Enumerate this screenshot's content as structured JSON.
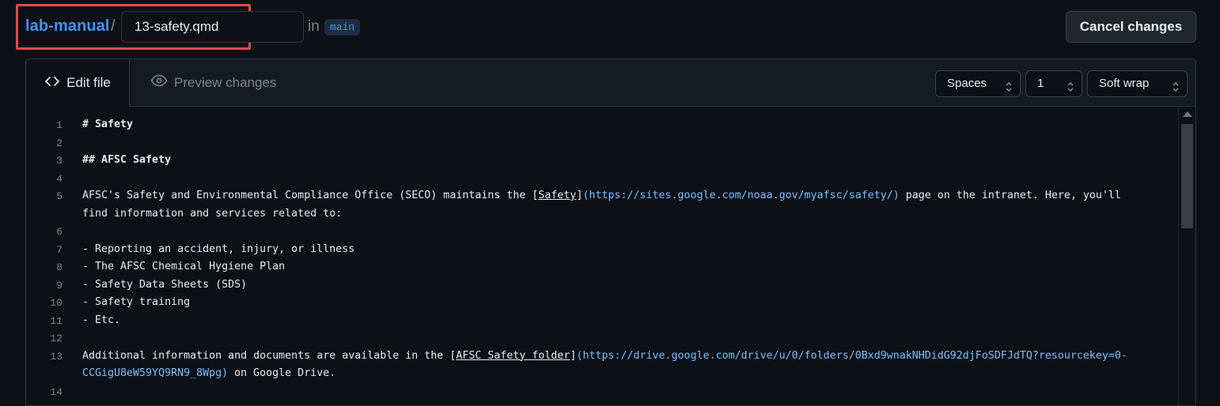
{
  "header": {
    "repo_name": "lab-manual",
    "separator": "/",
    "filename_value": "13-safety.qmd",
    "in_text": "in",
    "branch": "main",
    "cancel_label": "Cancel changes"
  },
  "editor": {
    "tabs": {
      "edit": "Edit file",
      "preview": "Preview changes"
    },
    "indent_mode": "Spaces",
    "indent_size": "1",
    "wrap_mode": "Soft wrap"
  },
  "code_lines": [
    {
      "n": "1",
      "segments": [
        {
          "t": "# Safety",
          "k": "heading"
        }
      ]
    },
    {
      "n": "2",
      "segments": []
    },
    {
      "n": "3",
      "segments": [
        {
          "t": "## AFSC Safety",
          "k": "heading"
        }
      ]
    },
    {
      "n": "4",
      "segments": []
    },
    {
      "n": "5",
      "segments": [
        {
          "t": "AFSC's Safety and Environmental Compliance Office (SECO) maintains the ",
          "k": "text"
        },
        {
          "t": "[",
          "k": "text"
        },
        {
          "t": "Safety",
          "k": "linktext"
        },
        {
          "t": "]",
          "k": "text"
        },
        {
          "t": "(https://sites.google.com/noaa.gov/myafsc/safety/)",
          "k": "url"
        },
        {
          "t": " page on the intranet. Here, you'll",
          "k": "text"
        }
      ]
    },
    {
      "n": "",
      "segments": [
        {
          "t": "find information and services related to:",
          "k": "text"
        }
      ]
    },
    {
      "n": "6",
      "segments": []
    },
    {
      "n": "7",
      "segments": [
        {
          "t": "- Reporting an accident, injury, or illness",
          "k": "text"
        }
      ]
    },
    {
      "n": "8",
      "segments": [
        {
          "t": "- The AFSC Chemical Hygiene Plan",
          "k": "text"
        }
      ]
    },
    {
      "n": "9",
      "segments": [
        {
          "t": "- Safety Data Sheets (SDS)",
          "k": "text"
        }
      ]
    },
    {
      "n": "10",
      "segments": [
        {
          "t": "- Safety training",
          "k": "text"
        }
      ]
    },
    {
      "n": "11",
      "segments": [
        {
          "t": "- Etc.",
          "k": "text"
        }
      ]
    },
    {
      "n": "12",
      "segments": []
    },
    {
      "n": "13",
      "segments": [
        {
          "t": "Additional information and documents are available in the ",
          "k": "text"
        },
        {
          "t": "[",
          "k": "text"
        },
        {
          "t": "AFSC Safety folder",
          "k": "linktext"
        },
        {
          "t": "]",
          "k": "text"
        },
        {
          "t": "(https://drive.google.com/drive/u/0/folders/0Bxd9wnakNHDidG92djFoSDFJdTQ?resourcekey=0-",
          "k": "url"
        }
      ]
    },
    {
      "n": "",
      "segments": [
        {
          "t": "CCGigU8eW59YQ9RN9_8Wpg)",
          "k": "url"
        },
        {
          "t": " on Google Drive.",
          "k": "text"
        }
      ]
    },
    {
      "n": "14",
      "segments": []
    }
  ]
}
